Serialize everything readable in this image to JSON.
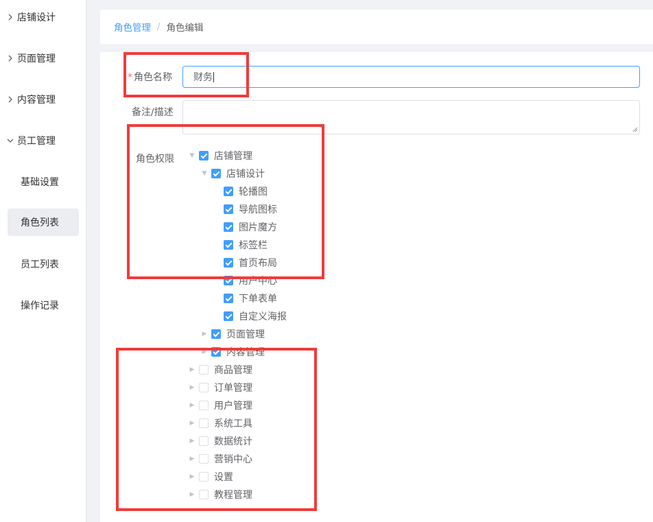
{
  "sidebar": {
    "groups": [
      {
        "label": "店铺设计",
        "expanded": false
      },
      {
        "label": "页面管理",
        "expanded": false
      },
      {
        "label": "内容管理",
        "expanded": false
      },
      {
        "label": "员工管理",
        "expanded": true
      }
    ],
    "sub_items": [
      {
        "label": "基础设置",
        "active": false
      },
      {
        "label": "角色列表",
        "active": true
      },
      {
        "label": "员工列表",
        "active": false
      },
      {
        "label": "操作记录",
        "active": false
      }
    ]
  },
  "breadcrumb": {
    "link": "角色管理",
    "separator": "/",
    "current": "角色编辑"
  },
  "form": {
    "required_mark": "*",
    "name_label": "角色名称",
    "name_value": "财务",
    "desc_label": "备注/描述",
    "perm_label": "角色权限"
  },
  "tree": [
    {
      "label": "店铺管理",
      "checked": true,
      "arrow": "expanded"
    },
    {
      "label": "店铺设计",
      "checked": true,
      "arrow": "expanded"
    },
    {
      "label": "轮播图",
      "checked": true,
      "arrow": "none"
    },
    {
      "label": "导航图标",
      "checked": true,
      "arrow": "none"
    },
    {
      "label": "图片魔方",
      "checked": true,
      "arrow": "none"
    },
    {
      "label": "标签栏",
      "checked": true,
      "arrow": "none"
    },
    {
      "label": "首页布局",
      "checked": true,
      "arrow": "none"
    },
    {
      "label": "用户中心",
      "checked": true,
      "arrow": "none"
    },
    {
      "label": "下单表单",
      "checked": true,
      "arrow": "none"
    },
    {
      "label": "自定义海报",
      "checked": true,
      "arrow": "none"
    },
    {
      "label": "页面管理",
      "checked": true,
      "arrow": "collapsed"
    },
    {
      "label": "内容管理",
      "checked": true,
      "arrow": "collapsed"
    },
    {
      "label": "商品管理",
      "checked": false,
      "arrow": "collapsed"
    },
    {
      "label": "订单管理",
      "checked": false,
      "arrow": "collapsed"
    },
    {
      "label": "用户管理",
      "checked": false,
      "arrow": "collapsed"
    },
    {
      "label": "系统工具",
      "checked": false,
      "arrow": "collapsed"
    },
    {
      "label": "数据统计",
      "checked": false,
      "arrow": "collapsed"
    },
    {
      "label": "营销中心",
      "checked": false,
      "arrow": "collapsed"
    },
    {
      "label": "设置",
      "checked": false,
      "arrow": "collapsed"
    },
    {
      "label": "教程管理",
      "checked": false,
      "arrow": "collapsed"
    }
  ],
  "colors": {
    "primary": "#409eff",
    "highlight_box": "#f23a3a"
  }
}
